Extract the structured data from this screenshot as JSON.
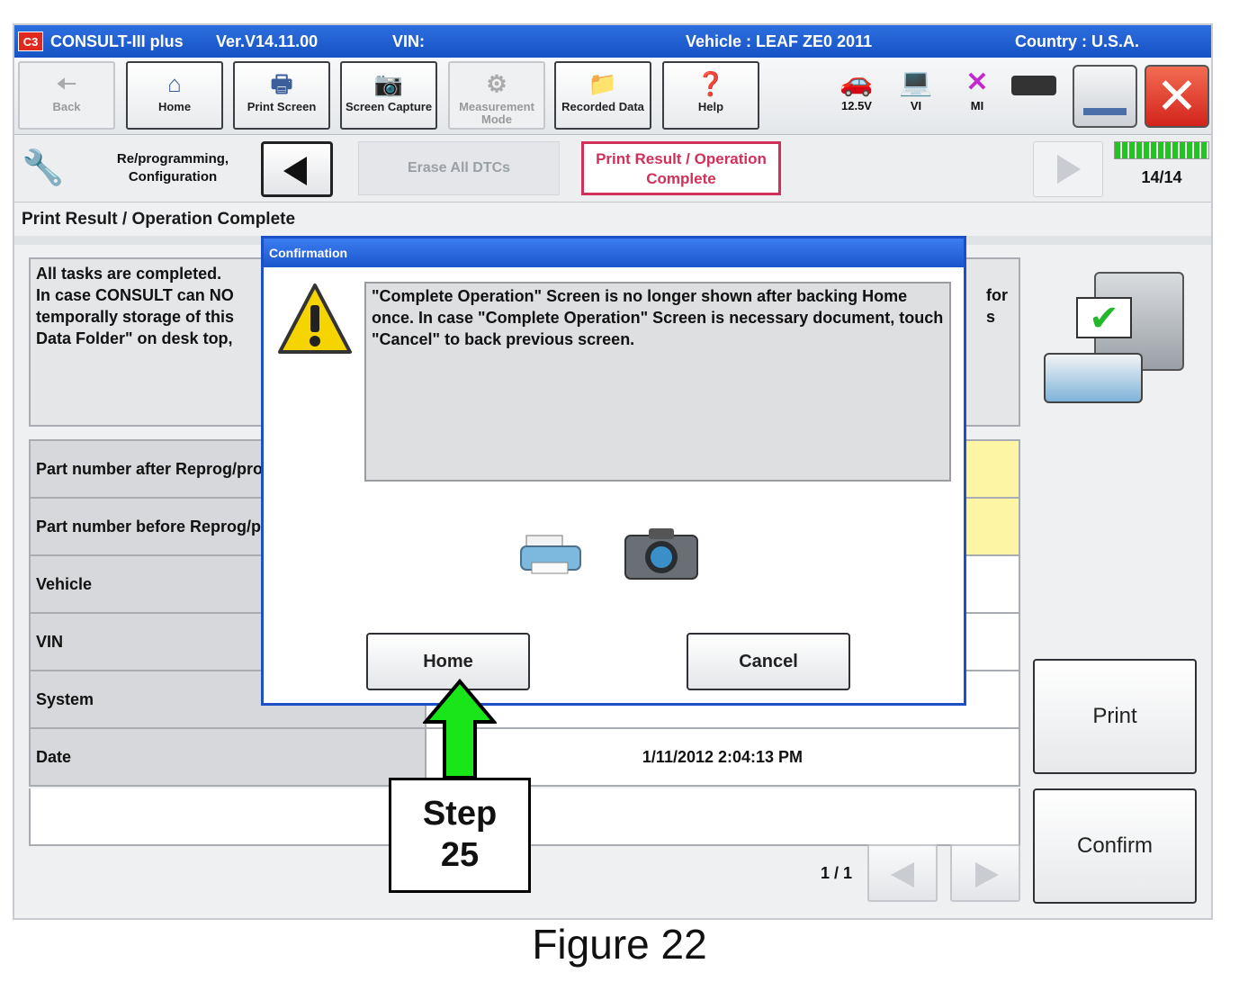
{
  "window": {
    "app_title": "CONSULT-III plus",
    "version": "Ver.V14.11.00",
    "vin_label": "VIN:",
    "vehicle": "Vehicle : LEAF ZE0 2011",
    "country": "Country : U.S.A.",
    "logo_text": "C3"
  },
  "toolbar": {
    "back": "Back",
    "home": "Home",
    "print_screen": "Print Screen",
    "screen_capture": "Screen Capture",
    "measurement_mode": "Measurement Mode",
    "recorded_data": "Recorded Data",
    "help": "Help",
    "battery_voltage": "12.5V",
    "vi": "VI",
    "mi": "MI"
  },
  "navbar": {
    "section": "Re/programming, Configuration",
    "prev_step": "Erase All DTCs",
    "current_step": "Print Result / Operation Complete",
    "progress": "14/14",
    "progress_fraction": 1.0
  },
  "page": {
    "heading": "Print Result / Operation Complete",
    "message_lines": [
      "All tasks are completed.",
      "In case CONSULT can NO",
      "temporally storage of this",
      "Data Folder\" on desk top,"
    ],
    "message_right": [
      "for",
      "s"
    ],
    "rows": [
      {
        "label": "Part number after Reprog/programming",
        "value": ""
      },
      {
        "label": "Part number before Reprog/programming",
        "value": ""
      },
      {
        "label": "Vehicle",
        "value": ""
      },
      {
        "label": "VIN",
        "value": ""
      },
      {
        "label": "System",
        "value": ""
      },
      {
        "label": "Date",
        "value": "1/11/2012 2:04:13 PM"
      }
    ],
    "page_indicator": "1 / 1",
    "print_button": "Print",
    "confirm_button": "Confirm"
  },
  "dialog": {
    "title": "Confirmation",
    "message": "\"Complete Operation\" Screen is no longer shown after backing Home once. In case \"Complete Operation\" Screen is necessary document, touch \"Cancel\" to back previous screen.",
    "home_button": "Home",
    "cancel_button": "Cancel"
  },
  "callout": {
    "step_word": "Step",
    "step_number": "25"
  },
  "caption": "Figure 22",
  "colors": {
    "titlebar": "#1652c4",
    "current_step_border": "#d0305a",
    "arrow": "#19e619",
    "yellow_cell": "#fdf5a3"
  }
}
